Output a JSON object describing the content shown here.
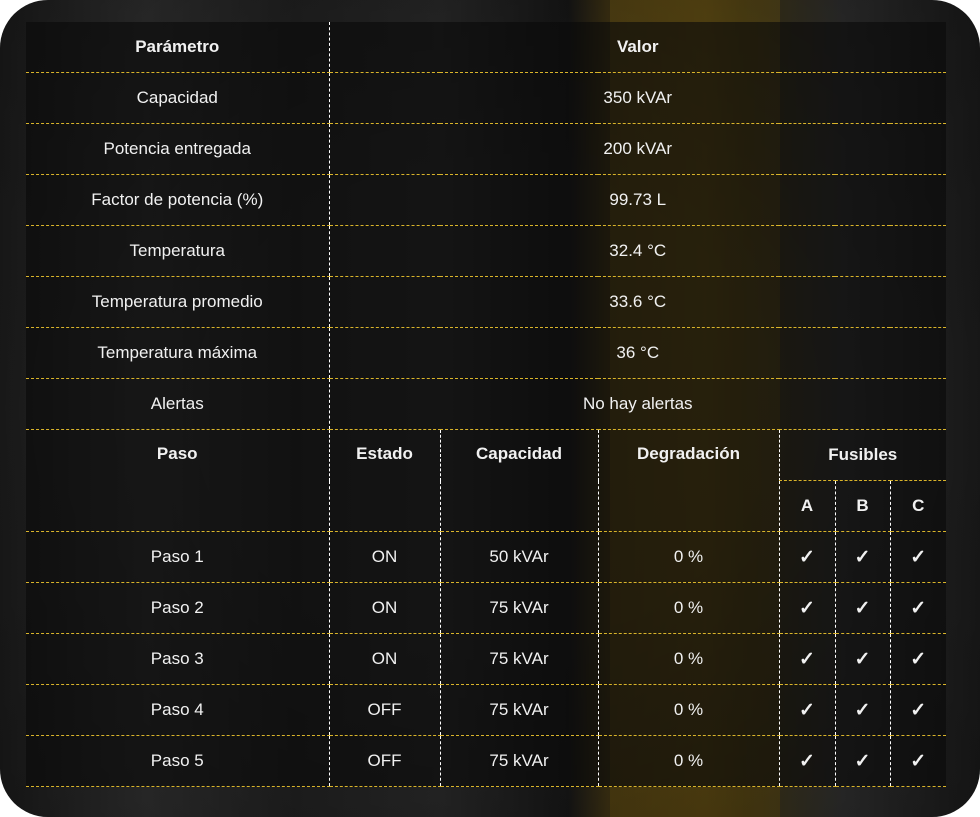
{
  "summary": {
    "headers": {
      "param": "Parámetro",
      "value": "Valor"
    },
    "rows": [
      {
        "label": "Capacidad",
        "value": "350 kVAr"
      },
      {
        "label": "Potencia entregada",
        "value": "200 kVAr"
      },
      {
        "label": "Factor de potencia (%)",
        "value": "99.73 L"
      },
      {
        "label": "Temperatura",
        "value": "32.4 °C"
      },
      {
        "label": "Temperatura promedio",
        "value": "33.6 °C"
      },
      {
        "label": "Temperatura máxima",
        "value": "36 °C"
      },
      {
        "label": "Alertas",
        "value": "No hay alertas"
      }
    ]
  },
  "steps": {
    "headers": {
      "paso": "Paso",
      "estado": "Estado",
      "capacidad": "Capacidad",
      "degradacion": "Degradación",
      "fusibles": "Fusibles",
      "fuse_a": "A",
      "fuse_b": "B",
      "fuse_c": "C"
    },
    "rows": [
      {
        "paso": "Paso 1",
        "estado": "ON",
        "capacidad": "50 kVAr",
        "degradacion": "0 %",
        "a": "✓",
        "b": "✓",
        "c": "✓"
      },
      {
        "paso": "Paso 2",
        "estado": "ON",
        "capacidad": "75 kVAr",
        "degradacion": "0 %",
        "a": "✓",
        "b": "✓",
        "c": "✓"
      },
      {
        "paso": "Paso 3",
        "estado": "ON",
        "capacidad": "75 kVAr",
        "degradacion": "0 %",
        "a": "✓",
        "b": "✓",
        "c": "✓"
      },
      {
        "paso": "Paso 4",
        "estado": "OFF",
        "capacidad": "75 kVAr",
        "degradacion": "0 %",
        "a": "✓",
        "b": "✓",
        "c": "✓"
      },
      {
        "paso": "Paso 5",
        "estado": "OFF",
        "capacidad": "75 kVAr",
        "degradacion": "0 %",
        "a": "✓",
        "b": "✓",
        "c": "✓"
      }
    ]
  },
  "colors": {
    "divider": "#d9b42a",
    "text": "#f1f1f1"
  }
}
